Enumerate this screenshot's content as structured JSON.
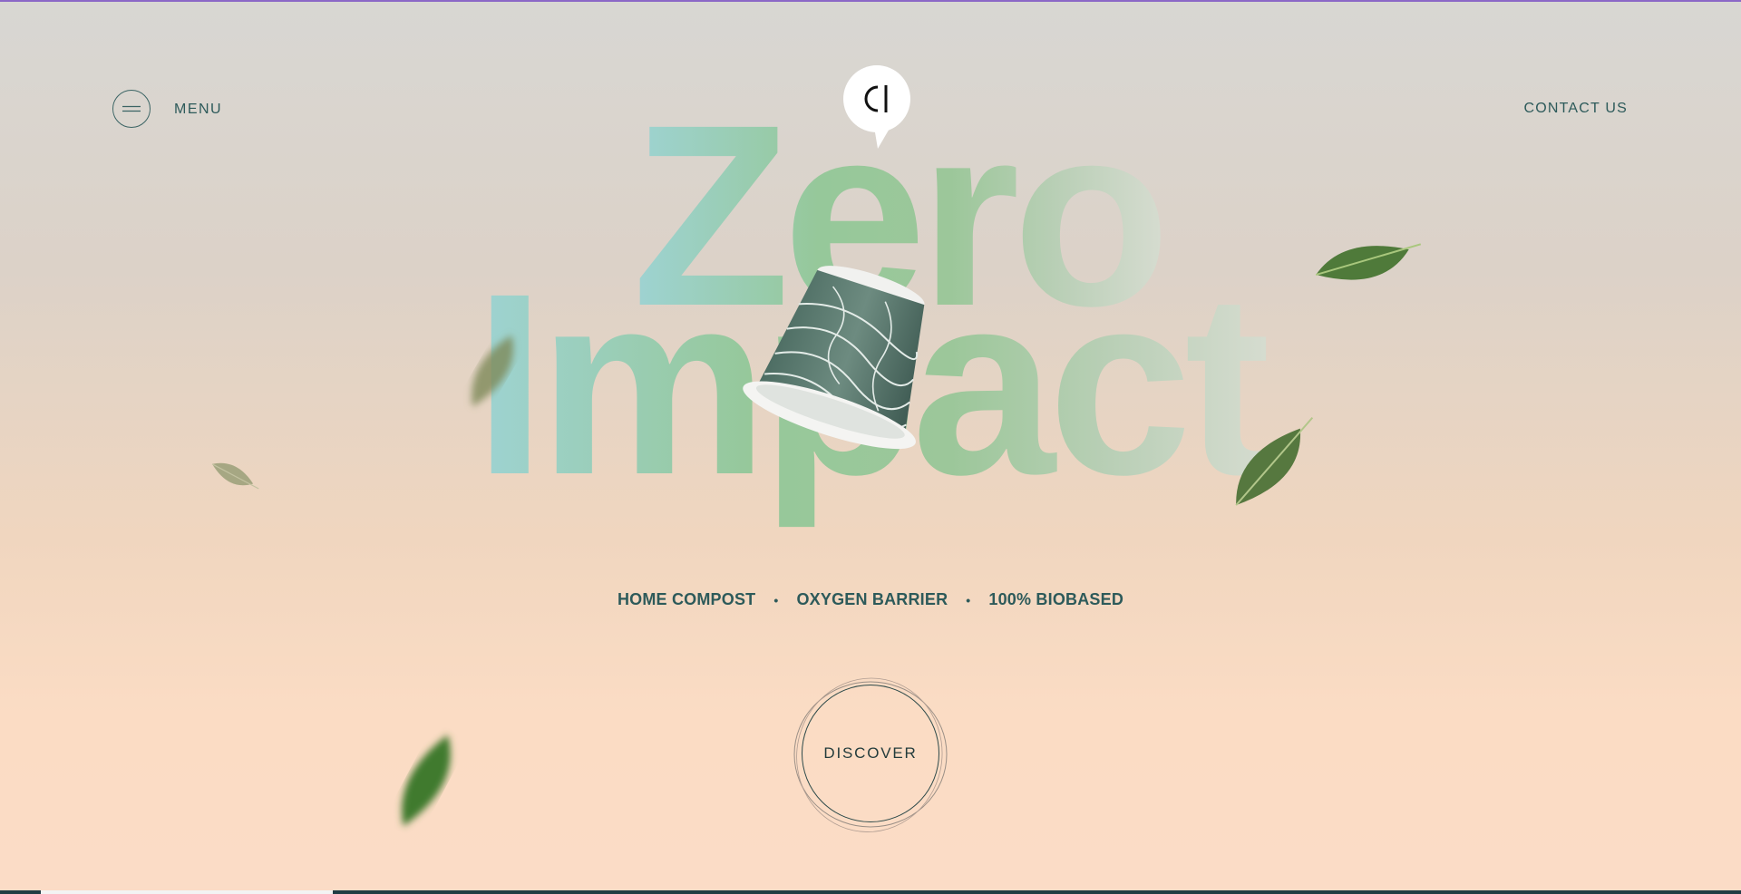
{
  "header": {
    "menu_label": "MENU",
    "contact_label": "CONTACT US",
    "logo_text": "CI"
  },
  "hero": {
    "line1": "Zero",
    "line2": "Impact"
  },
  "features": {
    "items": [
      "HOME COMPOST",
      "OXYGEN BARRIER",
      "100% BIOBASED"
    ],
    "separator": "•"
  },
  "cta": {
    "discover_label": "DISCOVER"
  },
  "icons": {
    "menu": "hamburger-icon",
    "logo": "speech-bubble-logo",
    "decor": [
      "leaf-icon",
      "coffee-capsule"
    ]
  },
  "colors": {
    "accent_top_bar": "#8b68c7",
    "text": "#2d5a5a",
    "hero_teal": "#9fd3cf",
    "hero_green": "#94c793",
    "bottom_bar": "#1f3c45"
  }
}
